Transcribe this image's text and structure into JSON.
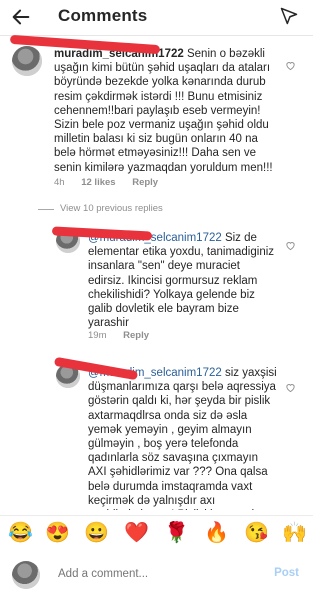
{
  "header": {
    "title": "Comments"
  },
  "comments": [
    {
      "username": "muradim_selcanim1722",
      "text": " Senin o bəzəkli uşağın kimi bütün şəhid uşaqları da ataları böyründə bezekde yolka kənarında durub resim çəkdirmək istərdi !!! Bunu etmisiniz cehennem!!bari paylaşıb eseb vermeyin! Sizin bele poz vermaniz uşağın şəhid oldu milletin balası ki siz bugün onların 40 na belə hörmət etməyəsiniz!!! Daha sen ve senin kimilərə yazmaqdan yoruldum men!!!",
      "time": "4h",
      "likes": "12 likes",
      "reply": "Reply"
    },
    {
      "username": "",
      "mention": "@muradim_selcanim1722",
      "text": " Siz de elementar etika yoxdu, tanimadiginiz insanlara \"sen\" deye muraciet edirsiz. Ikincisi gormursuz reklam chekilishidi? Yolkaya gelende biz galib dovletik ele bayram bize yarashir",
      "time": "19m",
      "reply": "Reply"
    },
    {
      "username": "",
      "mention": "@muradim_selcanim1722",
      "text": " siz yaxşisi düşmanlarımıza qarşı belə aqressiya göstərin qaldı ki, hər şeyda bir pislik axtarmaqdlrsa onda siz də əsla yemək yeməyin , geyim almayın gülməyin , boş yerə telefonda qadınlarla söz savaşına çıxmayın AXI şəhidlərimiz var ??? Ona qalsa belə durumda imstaqramda vaxt keçirmək də yalnışdır axı şəgidlərimiz var ! Pisliyi hər şeydə tapmaq olar , BİZİM MİLLƏT ONSUZDA QƏDİRİNƏ..."
    }
  ],
  "view_replies": "View 10 previous replies",
  "emoji_bar": [
    "😂",
    "😍",
    "😀",
    "❤️",
    "🌹",
    "🔥",
    "😘",
    "🙌"
  ],
  "composer": {
    "placeholder": "Add a comment...",
    "post_label": "Post"
  },
  "colors": {
    "mention": "#2a5f97",
    "redaction": "#e8333d",
    "post": "#a9cff5"
  }
}
